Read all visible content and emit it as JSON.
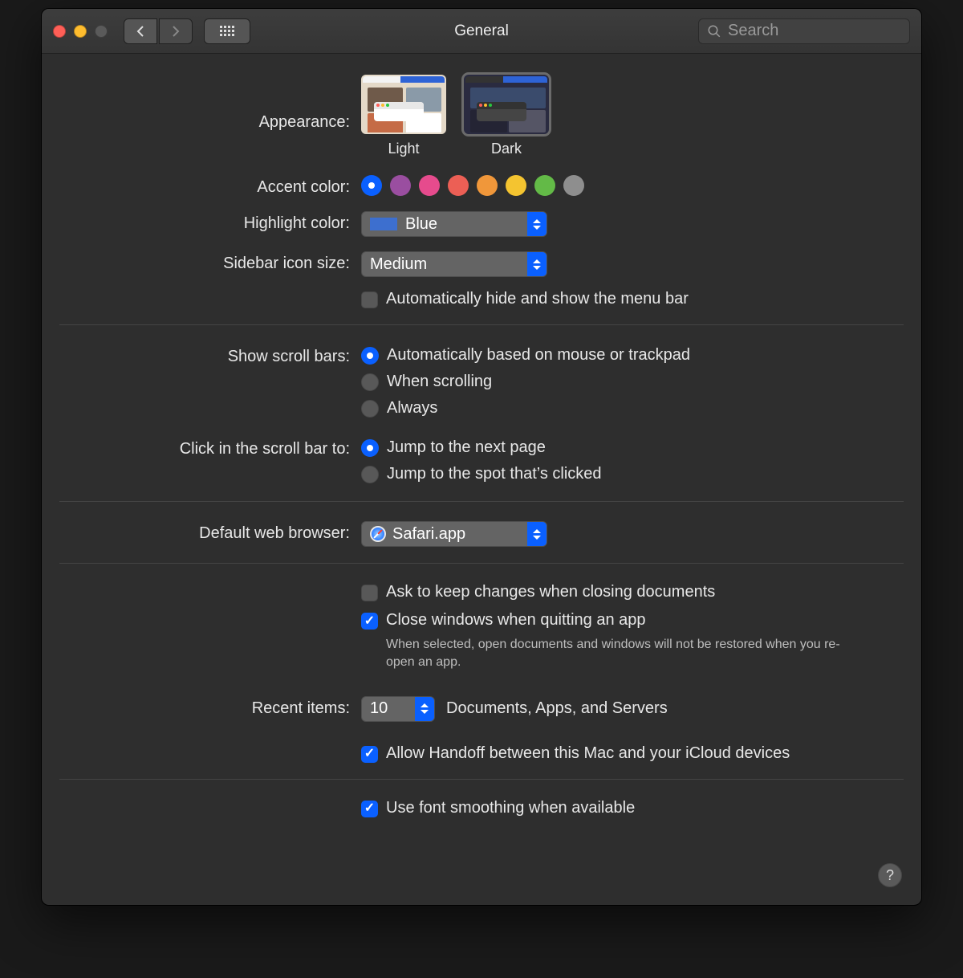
{
  "window": {
    "title": "General",
    "search_placeholder": "Search"
  },
  "appearance": {
    "label": "Appearance:",
    "light": "Light",
    "dark": "Dark",
    "selected": "Dark"
  },
  "accent": {
    "label": "Accent color:",
    "colors": [
      "#0a60ff",
      "#9a4ea0",
      "#e64b8d",
      "#ec5f55",
      "#f0973a",
      "#f4c430",
      "#63ba47",
      "#8e8e8e"
    ],
    "selected_index": 0
  },
  "highlight": {
    "label": "Highlight color:",
    "value": "Blue"
  },
  "sidebar_size": {
    "label": "Sidebar icon size:",
    "value": "Medium"
  },
  "auto_hide_menu": {
    "label": "Automatically hide and show the menu bar",
    "checked": false
  },
  "scroll_bars": {
    "label": "Show scroll bars:",
    "options": [
      "Automatically based on mouse or trackpad",
      "When scrolling",
      "Always"
    ],
    "selected_index": 0
  },
  "scroll_click": {
    "label": "Click in the scroll bar to:",
    "options": [
      "Jump to the next page",
      "Jump to the spot that’s clicked"
    ],
    "selected_index": 0
  },
  "browser": {
    "label": "Default web browser:",
    "value": "Safari.app"
  },
  "ask_keep": {
    "label": "Ask to keep changes when closing documents",
    "checked": false
  },
  "close_windows": {
    "label": "Close windows when quitting an app",
    "checked": true,
    "hint": "When selected, open documents and windows will not be restored when you re-open an app."
  },
  "recent": {
    "label": "Recent items:",
    "value": "10",
    "suffix": "Documents, Apps, and Servers"
  },
  "handoff": {
    "label": "Allow Handoff between this Mac and your iCloud devices",
    "checked": true
  },
  "font_smoothing": {
    "label": "Use font smoothing when available",
    "checked": true
  },
  "help": "?"
}
